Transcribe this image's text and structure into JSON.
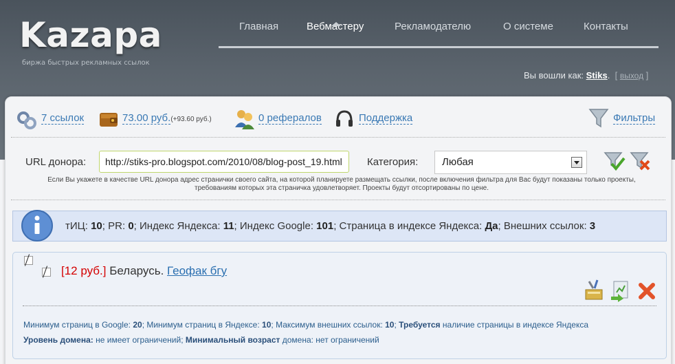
{
  "header": {
    "logo": "Kazapa",
    "tagline": "биржа быстрых рекламных ссылок",
    "nav": [
      {
        "label": "Главная",
        "active": false
      },
      {
        "label": "Вебмастеру",
        "active": true
      },
      {
        "label": "Рекламодателю",
        "active": false
      },
      {
        "label": "О системе",
        "active": false
      },
      {
        "label": "Контакты",
        "active": false
      }
    ],
    "login_text": "Вы вошли как:",
    "username": "Stiks",
    "logout": "выход",
    "bracket_open": "[",
    "bracket_close": "]"
  },
  "stats": {
    "links": "7 ссылок",
    "balance": "73.00 руб.",
    "balance_extra": "(+93.60 руб.)",
    "referrals": "0 рефералов",
    "support": "Поддержка",
    "filters": "Фильтры"
  },
  "filter": {
    "url_label": "URL донора:",
    "url_value": "http://stiks-pro.blogspot.com/2010/08/blog-post_19.html",
    "category_label": "Категория:",
    "category_value": "Любая",
    "hint": "Если Вы укажете в качестве URL донора адрес странички своего сайта, на которой планируете размещать ссылки, после включения фильтра для Вас будут показаны только проекты, требованиям которых эта страничка удовлетворяет. Проекты будут отсортированы по цене."
  },
  "info": {
    "tic_label": "тИЦ:",
    "tic": "10",
    "pr_label": "PR:",
    "pr": "0",
    "yandex_label": "Индекс Яндекса:",
    "yandex": "11",
    "google_label": "Индекс Google:",
    "google": "101",
    "page_label": "Страница в индексе Яндекса:",
    "page": "Да",
    "ext_label": "Внешних ссылок:",
    "ext": "3"
  },
  "project": {
    "price": "[12 руб.]",
    "region": "Беларусь.",
    "name": "Геофак бгу",
    "req1_a": "Минимум страниц в Google:",
    "req1_b": "20",
    "req1_c": "Минимум страниц в Яндексе:",
    "req1_d": "10",
    "req1_e": "Максимум внешних ссылок:",
    "req1_f": "10",
    "req1_g": "Требуется",
    "req1_h": "наличие страницы в индексе Яндекса",
    "req2_a": "Уровень домена:",
    "req2_b": "не имеет ограничений",
    "req2_c": "Минимальный возраст",
    "req2_d": "домена: нет ограничений"
  }
}
